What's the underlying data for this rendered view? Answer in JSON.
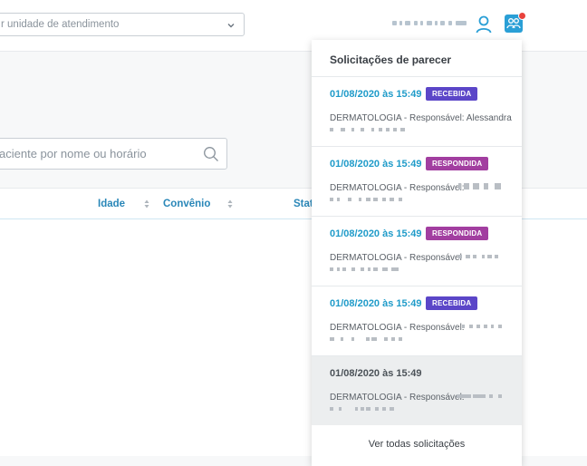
{
  "header": {
    "unit_select": {
      "placeholder": "r unidade de atendimento"
    }
  },
  "search": {
    "placeholder": "aciente por nome ou horário"
  },
  "table": {
    "columns": [
      {
        "label": "Idade"
      },
      {
        "label": "Convênio"
      },
      {
        "label": "Stat"
      }
    ]
  },
  "panel": {
    "title": "Solicitações de parecer",
    "items": [
      {
        "date": "01/08/2020 às 15:49",
        "status": "RECEBIDA",
        "description": "DERMATOLOGIA - Responsável: Alessandra"
      },
      {
        "date": "01/08/2020 às 15:49",
        "status": "RESPONDIDA",
        "description": "DERMATOLOGIA - Responsável:"
      },
      {
        "date": "01/08/2020 às 15:49",
        "status": "RESPONDIDA",
        "description": "DERMATOLOGIA - Responsável"
      },
      {
        "date": "01/08/2020 às 15:49",
        "status": "RECEBIDA",
        "description": "DERMATOLOGIA - Responsável:"
      },
      {
        "date": "01/08/2020 às 15:49",
        "status": "",
        "description": "DERMATOLOGIA - Responsável:"
      }
    ],
    "footer_link": "Ver todas solicitações"
  },
  "colors": {
    "accent": "#2a9fd6",
    "recebida": "#5b46c8",
    "respondida": "#a23ea0",
    "notification": "#e8423c"
  },
  "icons": {
    "user": "user-icon",
    "team": "team-icon",
    "search": "search-icon",
    "chevron": "chevron-down-icon",
    "sort": "sort-icon"
  }
}
